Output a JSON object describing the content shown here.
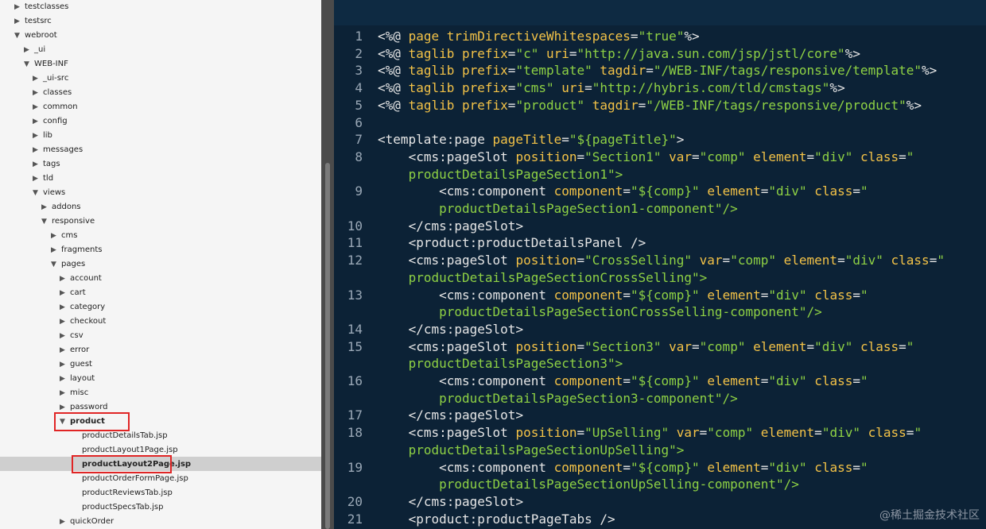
{
  "tree": {
    "items": [
      {
        "label": "testclasses",
        "expanded": false
      },
      {
        "label": "testsrc",
        "expanded": false
      },
      {
        "label": "webroot",
        "expanded": true
      },
      {
        "label": "_ui",
        "expanded": false
      },
      {
        "label": "WEB-INF",
        "expanded": true
      },
      {
        "label": "_ui-src",
        "expanded": false
      },
      {
        "label": "classes",
        "expanded": false
      },
      {
        "label": "common",
        "expanded": false
      },
      {
        "label": "config",
        "expanded": false
      },
      {
        "label": "lib",
        "expanded": false
      },
      {
        "label": "messages",
        "expanded": false
      },
      {
        "label": "tags",
        "expanded": false
      },
      {
        "label": "tld",
        "expanded": false
      },
      {
        "label": "views",
        "expanded": true
      },
      {
        "label": "addons",
        "expanded": false
      },
      {
        "label": "responsive",
        "expanded": true
      },
      {
        "label": "cms",
        "expanded": false
      },
      {
        "label": "fragments",
        "expanded": false
      },
      {
        "label": "pages",
        "expanded": true
      },
      {
        "label": "account",
        "expanded": false
      },
      {
        "label": "cart",
        "expanded": false
      },
      {
        "label": "category",
        "expanded": false
      },
      {
        "label": "checkout",
        "expanded": false
      },
      {
        "label": "csv",
        "expanded": false
      },
      {
        "label": "error",
        "expanded": false
      },
      {
        "label": "guest",
        "expanded": false
      },
      {
        "label": "layout",
        "expanded": false
      },
      {
        "label": "misc",
        "expanded": false
      },
      {
        "label": "password",
        "expanded": false
      },
      {
        "label": "product",
        "expanded": true
      },
      {
        "label": "productDetailsTab.jsp"
      },
      {
        "label": "productLayout1Page.jsp"
      },
      {
        "label": "productLayout2Page.jsp",
        "selected": true
      },
      {
        "label": "productOrderFormPage.jsp"
      },
      {
        "label": "productReviewsTab.jsp"
      },
      {
        "label": "productSpecsTab.jsp"
      },
      {
        "label": "quickOrder",
        "expanded": false
      }
    ]
  },
  "editor": {
    "lines": [
      {
        "n": "1",
        "t": "<%@ page trimDirectiveWhitespaces=\"true\"%>"
      },
      {
        "n": "2",
        "t": "<%@ taglib prefix=\"c\" uri=\"http://java.sun.com/jsp/jstl/core\"%>"
      },
      {
        "n": "3",
        "t": "<%@ taglib prefix=\"template\" tagdir=\"/WEB-INF/tags/responsive/template\"%>"
      },
      {
        "n": "4",
        "t": "<%@ taglib prefix=\"cms\" uri=\"http://hybris.com/tld/cmstags\"%>"
      },
      {
        "n": "5",
        "t": "<%@ taglib prefix=\"product\" tagdir=\"/WEB-INF/tags/responsive/product\"%>"
      },
      {
        "n": "6",
        "t": ""
      },
      {
        "n": "7",
        "t": "<template:page pageTitle=\"${pageTitle}\">"
      },
      {
        "n": "8",
        "t": "    <cms:pageSlot position=\"Section1\" var=\"comp\" element=\"div\" class=\""
      },
      {
        "n": "",
        "t": "    productDetailsPageSection1\">"
      },
      {
        "n": "9",
        "t": "        <cms:component component=\"${comp}\" element=\"div\" class=\""
      },
      {
        "n": "",
        "t": "        productDetailsPageSection1-component\"/>"
      },
      {
        "n": "10",
        "t": "    </cms:pageSlot>"
      },
      {
        "n": "11",
        "t": "    <product:productDetailsPanel />"
      },
      {
        "n": "12",
        "t": "    <cms:pageSlot position=\"CrossSelling\" var=\"comp\" element=\"div\" class=\""
      },
      {
        "n": "",
        "t": "    productDetailsPageSectionCrossSelling\">"
      },
      {
        "n": "13",
        "t": "        <cms:component component=\"${comp}\" element=\"div\" class=\""
      },
      {
        "n": "",
        "t": "        productDetailsPageSectionCrossSelling-component\"/>"
      },
      {
        "n": "14",
        "t": "    </cms:pageSlot>"
      },
      {
        "n": "15",
        "t": "    <cms:pageSlot position=\"Section3\" var=\"comp\" element=\"div\" class=\""
      },
      {
        "n": "",
        "t": "    productDetailsPageSection3\">"
      },
      {
        "n": "16",
        "t": "        <cms:component component=\"${comp}\" element=\"div\" class=\""
      },
      {
        "n": "",
        "t": "        productDetailsPageSection3-component\"/>"
      },
      {
        "n": "17",
        "t": "    </cms:pageSlot>"
      },
      {
        "n": "18",
        "t": "    <cms:pageSlot position=\"UpSelling\" var=\"comp\" element=\"div\" class=\""
      },
      {
        "n": "",
        "t": "    productDetailsPageSectionUpSelling\">"
      },
      {
        "n": "19",
        "t": "        <cms:component component=\"${comp}\" element=\"div\" class=\""
      },
      {
        "n": "",
        "t": "        productDetailsPageSectionUpSelling-component\"/>"
      },
      {
        "n": "20",
        "t": "    </cms:pageSlot>"
      },
      {
        "n": "21",
        "t": "    <product:productPageTabs />"
      }
    ]
  },
  "watermark": "@稀土掘金技术社区",
  "colors": {
    "tree_bg": "#f5f5f5",
    "editor_bg": "#0c2236",
    "highlight_box": "#e02525",
    "string": "#8ed144",
    "attribute": "#f3c247"
  }
}
